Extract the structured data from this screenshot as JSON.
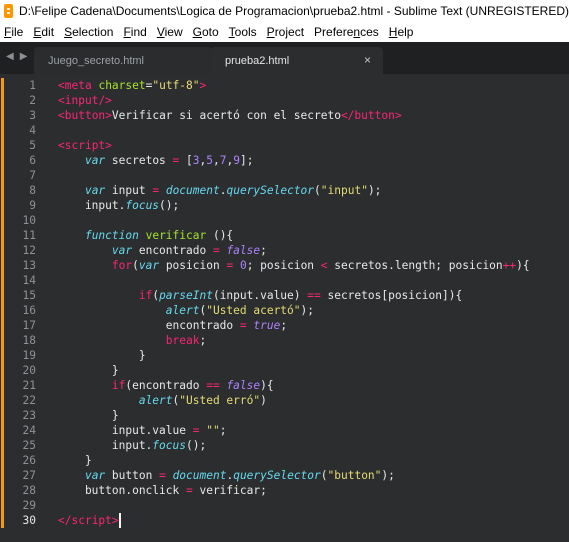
{
  "window": {
    "title": "D:\\Felipe Cadena\\Documents\\Logica de Programacion\\prueba2.html - Sublime Text (UNREGISTERED)",
    "icon": "sublime-text-icon"
  },
  "menu": [
    {
      "label": "File",
      "underline": "F",
      "rest": "ile"
    },
    {
      "label": "Edit",
      "underline": "E",
      "rest": "dit"
    },
    {
      "label": "Selection",
      "underline": "S",
      "rest": "election"
    },
    {
      "label": "Find",
      "underline": "F",
      "rest": "ind"
    },
    {
      "label": "View",
      "underline": "V",
      "rest": "iew"
    },
    {
      "label": "Goto",
      "underline": "G",
      "rest": "oto"
    },
    {
      "label": "Tools",
      "underline": "T",
      "rest": "ools"
    },
    {
      "label": "Project",
      "underline": "P",
      "rest": "roject"
    },
    {
      "label": "Preferences",
      "underline": "n",
      "pre": "Prefere",
      "rest": "ces"
    },
    {
      "label": "Help",
      "underline": "H",
      "rest": "elp"
    }
  ],
  "nav": {
    "back": "◀",
    "forward": "▶"
  },
  "tabs": [
    {
      "label": "Juego_secreto.html",
      "active": false
    },
    {
      "label": "prueba2.html",
      "active": true,
      "close": "×"
    }
  ],
  "editor": {
    "active_line": 30,
    "lines": [
      {
        "n": "1",
        "mod": true,
        "tokens": [
          [
            "tag",
            "<"
          ],
          [
            "tag",
            "meta"
          ],
          [
            "plain",
            " "
          ],
          [
            "attr",
            "charset"
          ],
          [
            "plain",
            "="
          ],
          [
            "str",
            "\"utf-8\""
          ],
          [
            "tag",
            ">"
          ]
        ]
      },
      {
        "n": "2",
        "mod": true,
        "tokens": [
          [
            "tag",
            "<"
          ],
          [
            "tag",
            "input"
          ],
          [
            "tag",
            "/>"
          ]
        ]
      },
      {
        "n": "3",
        "mod": true,
        "tokens": [
          [
            "tag",
            "<"
          ],
          [
            "tag",
            "button"
          ],
          [
            "tag",
            ">"
          ],
          [
            "plain",
            "Verificar si acertó con el secreto"
          ],
          [
            "tag",
            "</"
          ],
          [
            "tag",
            "button"
          ],
          [
            "tag",
            ">"
          ]
        ]
      },
      {
        "n": "4",
        "mod": true,
        "tokens": []
      },
      {
        "n": "5",
        "mod": true,
        "tokens": [
          [
            "tag",
            "<"
          ],
          [
            "tag",
            "script"
          ],
          [
            "tag",
            ">"
          ]
        ]
      },
      {
        "n": "6",
        "mod": true,
        "tokens": [
          [
            "plain",
            "    "
          ],
          [
            "kw",
            "var"
          ],
          [
            "plain",
            " secretos "
          ],
          [
            "op",
            "="
          ],
          [
            "plain",
            " ["
          ],
          [
            "num",
            "3"
          ],
          [
            "plain",
            ","
          ],
          [
            "num",
            "5"
          ],
          [
            "plain",
            ","
          ],
          [
            "num",
            "7"
          ],
          [
            "plain",
            ","
          ],
          [
            "num",
            "9"
          ],
          [
            "plain",
            "];"
          ]
        ]
      },
      {
        "n": "7",
        "mod": true,
        "tokens": []
      },
      {
        "n": "8",
        "mod": true,
        "tokens": [
          [
            "plain",
            "    "
          ],
          [
            "kw",
            "var"
          ],
          [
            "plain",
            " input "
          ],
          [
            "op",
            "="
          ],
          [
            "plain",
            " "
          ],
          [
            "obj",
            "document"
          ],
          [
            "plain",
            "."
          ],
          [
            "func",
            "querySelector"
          ],
          [
            "plain",
            "("
          ],
          [
            "str",
            "\"input\""
          ],
          [
            "plain",
            ");"
          ]
        ]
      },
      {
        "n": "9",
        "mod": true,
        "tokens": [
          [
            "plain",
            "    input."
          ],
          [
            "func",
            "focus"
          ],
          [
            "plain",
            "();"
          ]
        ]
      },
      {
        "n": "10",
        "mod": true,
        "tokens": []
      },
      {
        "n": "11",
        "mod": true,
        "tokens": [
          [
            "plain",
            "    "
          ],
          [
            "kw",
            "function"
          ],
          [
            "plain",
            " "
          ],
          [
            "fn",
            "verificar"
          ],
          [
            "plain",
            " (){"
          ]
        ]
      },
      {
        "n": "12",
        "mod": true,
        "tokens": [
          [
            "plain",
            "        "
          ],
          [
            "kw",
            "var"
          ],
          [
            "plain",
            " encontrado "
          ],
          [
            "op",
            "="
          ],
          [
            "plain",
            " "
          ],
          [
            "const",
            "false"
          ],
          [
            "plain",
            ";"
          ]
        ]
      },
      {
        "n": "13",
        "mod": true,
        "tokens": [
          [
            "plain",
            "        "
          ],
          [
            "ctrl",
            "for"
          ],
          [
            "plain",
            "("
          ],
          [
            "kw",
            "var"
          ],
          [
            "plain",
            " posicion "
          ],
          [
            "op",
            "="
          ],
          [
            "plain",
            " "
          ],
          [
            "num",
            "0"
          ],
          [
            "plain",
            "; posicion "
          ],
          [
            "op",
            "<"
          ],
          [
            "plain",
            " secretos.length; posicion"
          ],
          [
            "op",
            "++"
          ],
          [
            "plain",
            "){"
          ]
        ]
      },
      {
        "n": "14",
        "mod": true,
        "tokens": []
      },
      {
        "n": "15",
        "mod": true,
        "tokens": [
          [
            "plain",
            "            "
          ],
          [
            "ctrl",
            "if"
          ],
          [
            "plain",
            "("
          ],
          [
            "func",
            "parseInt"
          ],
          [
            "plain",
            "(input.value) "
          ],
          [
            "op",
            "=="
          ],
          [
            "plain",
            " secretos[posicion]){"
          ]
        ]
      },
      {
        "n": "16",
        "mod": true,
        "tokens": [
          [
            "plain",
            "                "
          ],
          [
            "func",
            "alert"
          ],
          [
            "plain",
            "("
          ],
          [
            "str",
            "\"Usted acertó\""
          ],
          [
            "plain",
            ");"
          ]
        ]
      },
      {
        "n": "17",
        "mod": true,
        "tokens": [
          [
            "plain",
            "                encontrado "
          ],
          [
            "op",
            "="
          ],
          [
            "plain",
            " "
          ],
          [
            "const",
            "true"
          ],
          [
            "plain",
            ";"
          ]
        ]
      },
      {
        "n": "18",
        "mod": true,
        "tokens": [
          [
            "plain",
            "                "
          ],
          [
            "ctrl",
            "break"
          ],
          [
            "plain",
            ";"
          ]
        ]
      },
      {
        "n": "19",
        "mod": true,
        "tokens": [
          [
            "plain",
            "            }"
          ]
        ]
      },
      {
        "n": "20",
        "mod": true,
        "tokens": [
          [
            "plain",
            "        }"
          ]
        ]
      },
      {
        "n": "21",
        "mod": true,
        "tokens": [
          [
            "plain",
            "        "
          ],
          [
            "ctrl",
            "if"
          ],
          [
            "plain",
            "(encontrado "
          ],
          [
            "op",
            "=="
          ],
          [
            "plain",
            " "
          ],
          [
            "const",
            "false"
          ],
          [
            "plain",
            "){"
          ]
        ]
      },
      {
        "n": "22",
        "mod": true,
        "tokens": [
          [
            "plain",
            "            "
          ],
          [
            "func",
            "alert"
          ],
          [
            "plain",
            "("
          ],
          [
            "str",
            "\"Usted erró\""
          ],
          [
            "plain",
            ")"
          ]
        ]
      },
      {
        "n": "23",
        "mod": true,
        "tokens": [
          [
            "plain",
            "        }"
          ]
        ]
      },
      {
        "n": "24",
        "mod": true,
        "tokens": [
          [
            "plain",
            "        input.value "
          ],
          [
            "op",
            "="
          ],
          [
            "plain",
            " "
          ],
          [
            "str",
            "\"\""
          ],
          [
            "plain",
            ";"
          ]
        ]
      },
      {
        "n": "25",
        "mod": true,
        "tokens": [
          [
            "plain",
            "        input."
          ],
          [
            "func",
            "focus"
          ],
          [
            "plain",
            "();"
          ]
        ]
      },
      {
        "n": "26",
        "mod": true,
        "tokens": [
          [
            "plain",
            "    }"
          ]
        ]
      },
      {
        "n": "27",
        "mod": true,
        "tokens": [
          [
            "plain",
            "    "
          ],
          [
            "kw",
            "var"
          ],
          [
            "plain",
            " button "
          ],
          [
            "op",
            "="
          ],
          [
            "plain",
            " "
          ],
          [
            "obj",
            "document"
          ],
          [
            "plain",
            "."
          ],
          [
            "func",
            "querySelector"
          ],
          [
            "plain",
            "("
          ],
          [
            "str",
            "\"button\""
          ],
          [
            "plain",
            ");"
          ]
        ]
      },
      {
        "n": "28",
        "mod": true,
        "tokens": [
          [
            "plain",
            "    button.onclick "
          ],
          [
            "op",
            "="
          ],
          [
            "plain",
            " verificar;"
          ]
        ]
      },
      {
        "n": "29",
        "mod": true,
        "tokens": []
      },
      {
        "n": "30",
        "mod": true,
        "tokens": [
          [
            "tag",
            "</"
          ],
          [
            "tag",
            "script"
          ],
          [
            "tag",
            ">"
          ]
        ],
        "cursor": true
      }
    ]
  }
}
